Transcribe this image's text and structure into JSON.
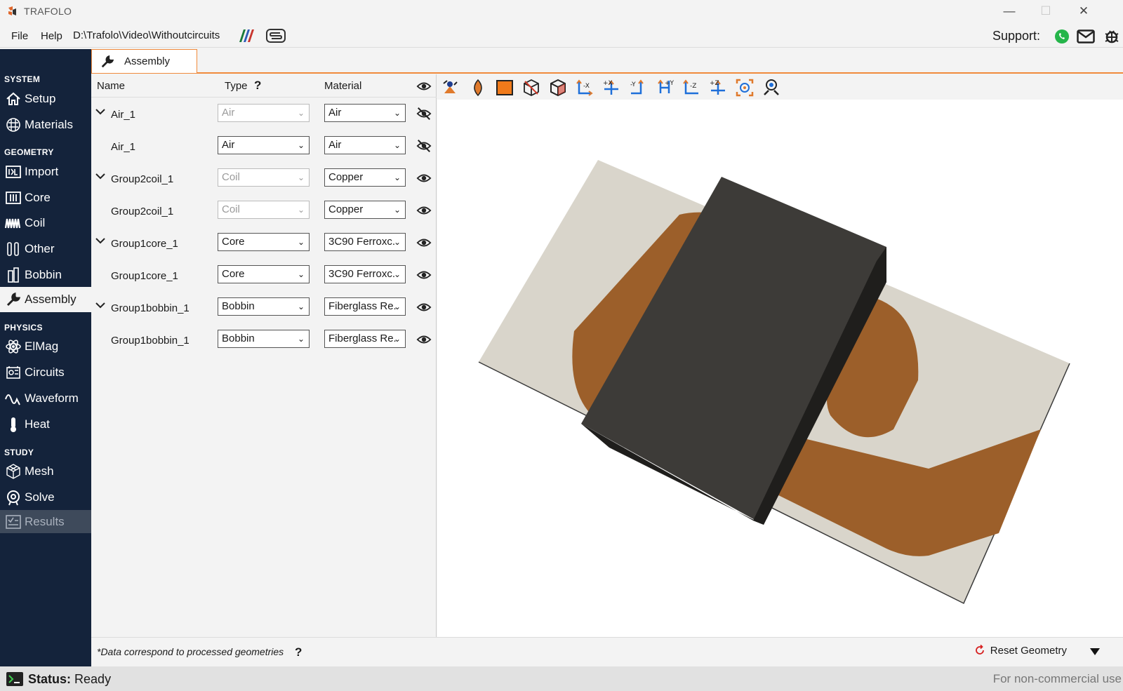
{
  "window": {
    "title": "TRAFOLO"
  },
  "menu": {
    "file": "File",
    "help": "Help",
    "path": "D:\\Trafolo\\Video\\Withoutcircuits",
    "support_label": "Support:"
  },
  "sidebar": {
    "sections": [
      "SYSTEM",
      "GEOMETRY",
      "PHYSICS",
      "STUDY"
    ],
    "items": [
      {
        "label": "Setup",
        "icon": "home-icon"
      },
      {
        "label": "Materials",
        "icon": "grid-icon"
      },
      {
        "label": "Import",
        "icon": "import-icon"
      },
      {
        "label": "Core",
        "icon": "core-icon"
      },
      {
        "label": "Coil",
        "icon": "coil-icon"
      },
      {
        "label": "Other",
        "icon": "other-icon"
      },
      {
        "label": "Bobbin",
        "icon": "bobbin-icon"
      },
      {
        "label": "Assembly",
        "icon": "wrench-icon"
      },
      {
        "label": "ElMag",
        "icon": "atom-icon"
      },
      {
        "label": "Circuits",
        "icon": "circuits-icon"
      },
      {
        "label": "Waveform",
        "icon": "wave-icon"
      },
      {
        "label": "Heat",
        "icon": "thermometer-icon"
      },
      {
        "label": "Mesh",
        "icon": "mesh-icon"
      },
      {
        "label": "Solve",
        "icon": "solve-icon"
      },
      {
        "label": "Results",
        "icon": "results-icon"
      }
    ]
  },
  "tab": {
    "label": "Assembly"
  },
  "table": {
    "headers": {
      "name": "Name",
      "type": "Type",
      "type_help": "?",
      "material": "Material"
    },
    "rows": [
      {
        "name": "Air_1",
        "type": "Air",
        "material": "Air",
        "expandable": true,
        "type_enabled": false,
        "visible": false
      },
      {
        "name": "Air_1",
        "type": "Air",
        "material": "Air",
        "expandable": false,
        "type_enabled": true,
        "visible": false
      },
      {
        "name": "Group2coil_1",
        "type": "Coil",
        "material": "Copper",
        "expandable": true,
        "type_enabled": false,
        "visible": true
      },
      {
        "name": "Group2coil_1",
        "type": "Coil",
        "material": "Copper",
        "expandable": false,
        "type_enabled": false,
        "visible": true
      },
      {
        "name": "Group1core_1",
        "type": "Core",
        "material": "3C90 Ferroxc.",
        "expandable": true,
        "type_enabled": true,
        "visible": true
      },
      {
        "name": "Group1core_1",
        "type": "Core",
        "material": "3C90 Ferroxc.",
        "expandable": false,
        "type_enabled": true,
        "visible": true
      },
      {
        "name": "Group1bobbin_1",
        "type": "Bobbin",
        "material": "Fiberglass Re.",
        "expandable": true,
        "type_enabled": true,
        "visible": true
      },
      {
        "name": "Group1bobbin_1",
        "type": "Bobbin",
        "material": "Fiberglass Re.",
        "expandable": false,
        "type_enabled": true,
        "visible": true
      }
    ]
  },
  "footer": {
    "note": "*Data correspond to processed geometries",
    "help": "?",
    "reset": "Reset Geometry"
  },
  "status": {
    "label": "Status:",
    "value": "Ready",
    "license": "For non-commercial use"
  },
  "colors": {
    "sidebar": "#14233b",
    "accent": "#f08a3c",
    "core": "#3d3b38",
    "copper": "#9c5f2a",
    "plate": "#d9d5cb"
  }
}
